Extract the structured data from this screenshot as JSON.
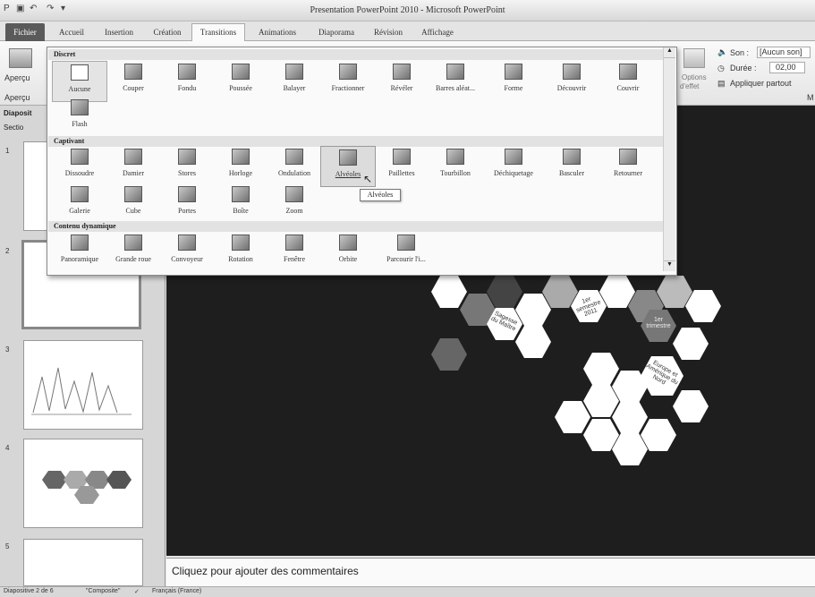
{
  "window": {
    "title": "Presentation PowerPoint 2010 - Microsoft PowerPoint"
  },
  "tabs": [
    {
      "label": "Fichier"
    },
    {
      "label": "Accueil"
    },
    {
      "label": "Insertion"
    },
    {
      "label": "Création"
    },
    {
      "label": "Transitions"
    },
    {
      "label": "Animations"
    },
    {
      "label": "Diaporama"
    },
    {
      "label": "Révision"
    },
    {
      "label": "Affichage"
    }
  ],
  "ribbon": {
    "apercu": "Aperçu",
    "apercu_group": "Aperçu",
    "options": "Options",
    "effect": "d'effet",
    "son_label": "Son :",
    "son_value": "[Aucun son]",
    "duree_label": "Durée :",
    "duree_value": "02,00",
    "apply_all": "Appliquer partout",
    "minutage": "M"
  },
  "gallery": {
    "sections": [
      {
        "title": "Discret",
        "items": [
          "Aucune",
          "Couper",
          "Fondu",
          "Poussée",
          "Balayer",
          "Fractionner",
          "Révéler",
          "Barres aléat...",
          "Forme",
          "Découvrir",
          "Couvrir",
          "Flash"
        ]
      },
      {
        "title": "Captivant",
        "items": [
          "Dissoudre",
          "Damier",
          "Stores",
          "Horloge",
          "Ondulation",
          "Alvéoles",
          "Paillettes",
          "Tourbillon",
          "Déchiquetage",
          "Basculer",
          "Retourner",
          "Galerie",
          "Cube",
          "Portes",
          "Boîte",
          "Zoom"
        ]
      },
      {
        "title": "Contenu dynamique",
        "items": [
          "Panoramique",
          "Grande roue",
          "Convoyeur",
          "Rotation",
          "Fenêtre",
          "Orbite",
          "Parcourir l'i..."
        ]
      }
    ],
    "hovered": "Alvéoles",
    "selected": "Aucune"
  },
  "tooltip": "Alvéoles",
  "left_pane": {
    "tab": "Diaposit",
    "section": "Sectio",
    "slides": [
      "1",
      "2",
      "3",
      "4",
      "5"
    ]
  },
  "slide_labels": {
    "hex_a": "Sagesse du Maître",
    "hex_b": "1er semestre 2011",
    "hex_c": "1er trimestre",
    "hex_d": "Europe et Amérique du Nord"
  },
  "notes": "Cliquez pour ajouter des commentaires",
  "status": {
    "slide": "Diapositive 2 de 6",
    "theme": "\"Composite\"",
    "language": "Français (France)"
  }
}
